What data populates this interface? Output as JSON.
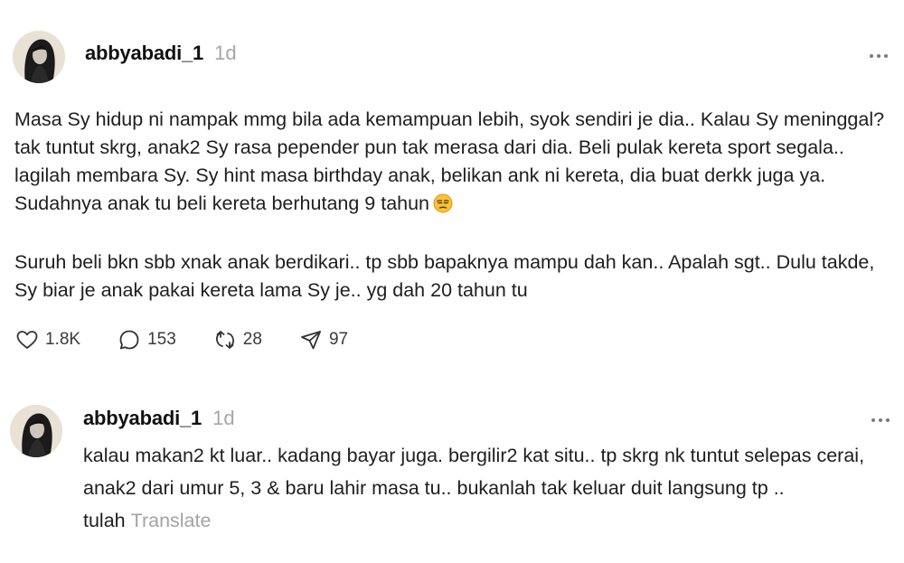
{
  "post": {
    "username": "abbyabadi_1",
    "time": "1d",
    "paragraph1_text": "Masa Sy hidup ni nampak mmg bila ada kemampuan lebih, syok sendiri je dia.. Kalau Sy meninggal? tak tuntut skrg, anak2 Sy rasa pepender pun tak merasa dari dia. Beli pulak kereta sport segala.. lagilah membara Sy. Sy hint masa birthday anak, belikan ank ni kereta, dia buat derkk juga ya. Sudahnya anak tu beli kereta berhutang 9 tahun",
    "paragraph1_emoji": "unamused-face-emoji",
    "paragraph2": "Suruh beli bkn sbb xnak anak berdikari.. tp sbb bapaknya mampu dah kan.. Apalah sgt.. Dulu takde, Sy biar je anak pakai kereta lama Sy je.. yg dah 20 tahun tu",
    "actions": {
      "likes": "1.8K",
      "comments": "153",
      "reposts": "28",
      "shares": "97"
    },
    "icons": [
      "heart-icon",
      "comment-icon",
      "repost-icon",
      "share-icon",
      "more-icon"
    ]
  },
  "reply": {
    "username": "abbyabadi_1",
    "time": "1d",
    "text": "kalau makan2 kt luar.. kadang bayar juga. bergilir2 kat situ.. tp skrg nk tuntut selepas cerai, anak2 dari umur 5, 3 & baru lahir masa tu.. bukanlah tak keluar duit langsung tp .. tulah",
    "translate_label": "Translate"
  },
  "colors": {
    "text": "#1e1e1e",
    "muted": "#a6a6a6",
    "background": "#ffffff"
  }
}
